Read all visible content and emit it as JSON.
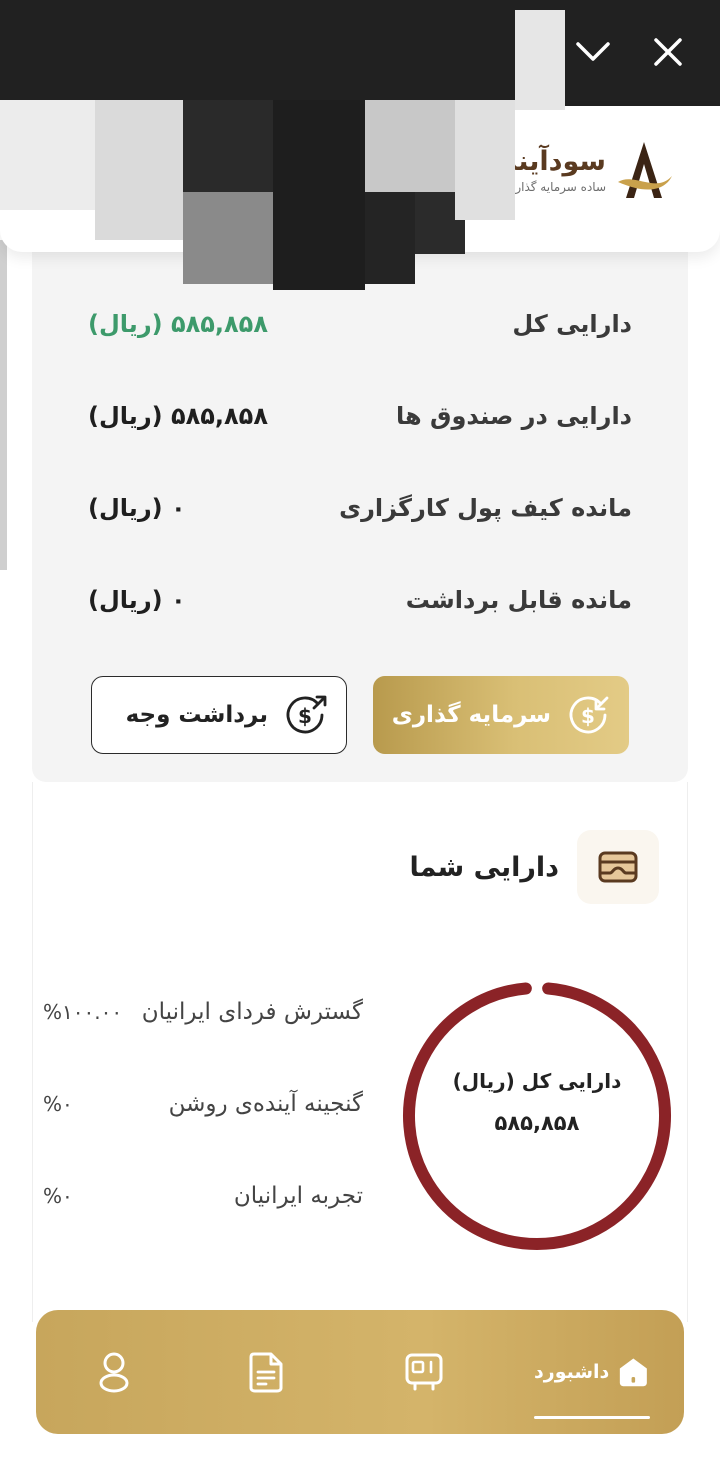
{
  "header": {
    "app_name": "سودآیند",
    "tagline": "ساده سرمایه گذاری کنید"
  },
  "summary": {
    "rows": [
      {
        "label": "دارایی کل",
        "value": "۵۸۵,۸۵۸ (ریال)"
      },
      {
        "label": "دارایی در صندوق ها",
        "value": "۵۸۵,۸۵۸ (ریال)"
      },
      {
        "label": "مانده کیف پول کارگزاری",
        "value": "۰ (ریال)"
      },
      {
        "label": "مانده قابل برداشت",
        "value": "۰ (ریال)"
      }
    ],
    "invest_label": "سرمایه گذاری",
    "withdraw_label": "برداشت وجه"
  },
  "assets": {
    "title": "دارایی شما",
    "legend": [
      {
        "name": "گسترش فردای ایرانیان",
        "percent": "%۱۰۰.۰۰"
      },
      {
        "name": "گنجینه آینده‌ی روشن",
        "percent": "%۰"
      },
      {
        "name": "تجربه ایرانیان",
        "percent": "%۰"
      }
    ],
    "donut_caption": "دارایی کل (ریال)",
    "donut_value": "۵۸۵,۸۵۸",
    "share_fraction": 1.0,
    "ring_color": "#8b2327"
  },
  "colors": {
    "accent_gold": "#c7a65c",
    "positive_green": "#3d9a6b",
    "topbar": "#212121"
  },
  "nav": {
    "dashboard_label": "داشبورد",
    "icons": [
      "home-icon",
      "card-icon",
      "document-icon",
      "user-icon"
    ]
  }
}
